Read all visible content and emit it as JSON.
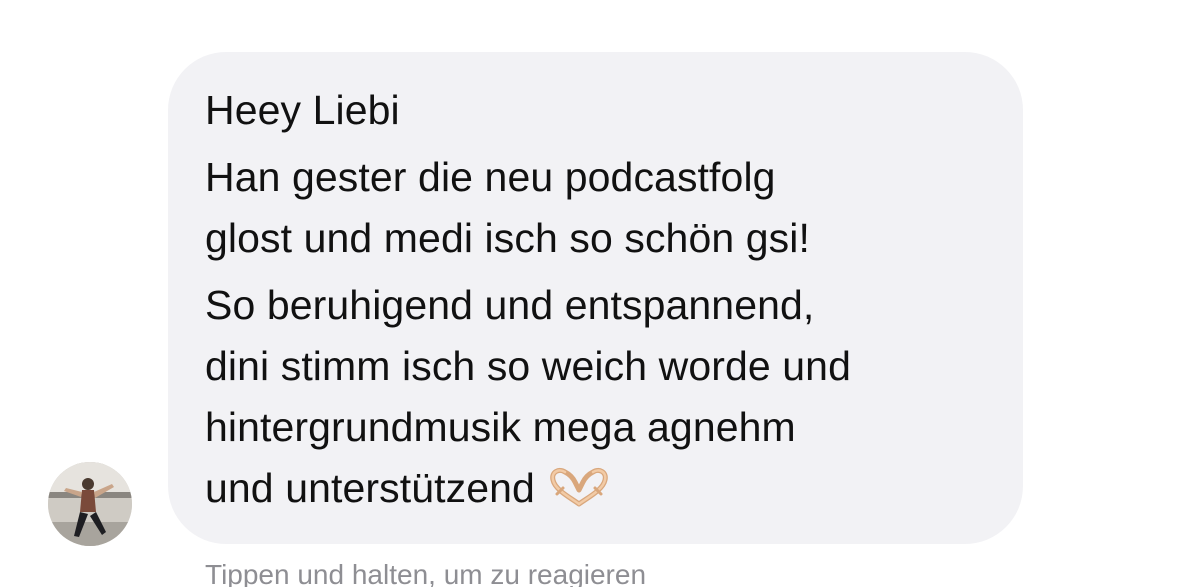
{
  "contact": {
    "avatar_icon": "profile-photo-avatar"
  },
  "message": {
    "greeting": "Heey Liebi",
    "paragraph_1": [
      "Han gester die neu podcastfolg",
      "glost und medi isch so schön gsi!"
    ],
    "paragraph_2": [
      "So beruhigend und entspannend,",
      "dini stimm isch so weich worde und",
      "hintergrundmusik mega agnehm",
      "und unterstützend"
    ],
    "emoji": "heart-hands-emoji"
  },
  "hint": "Tippen und halten, um zu reagieren",
  "colors": {
    "bubble": "#f2f2f5",
    "text": "#111111",
    "hint": "#8e8e93"
  }
}
